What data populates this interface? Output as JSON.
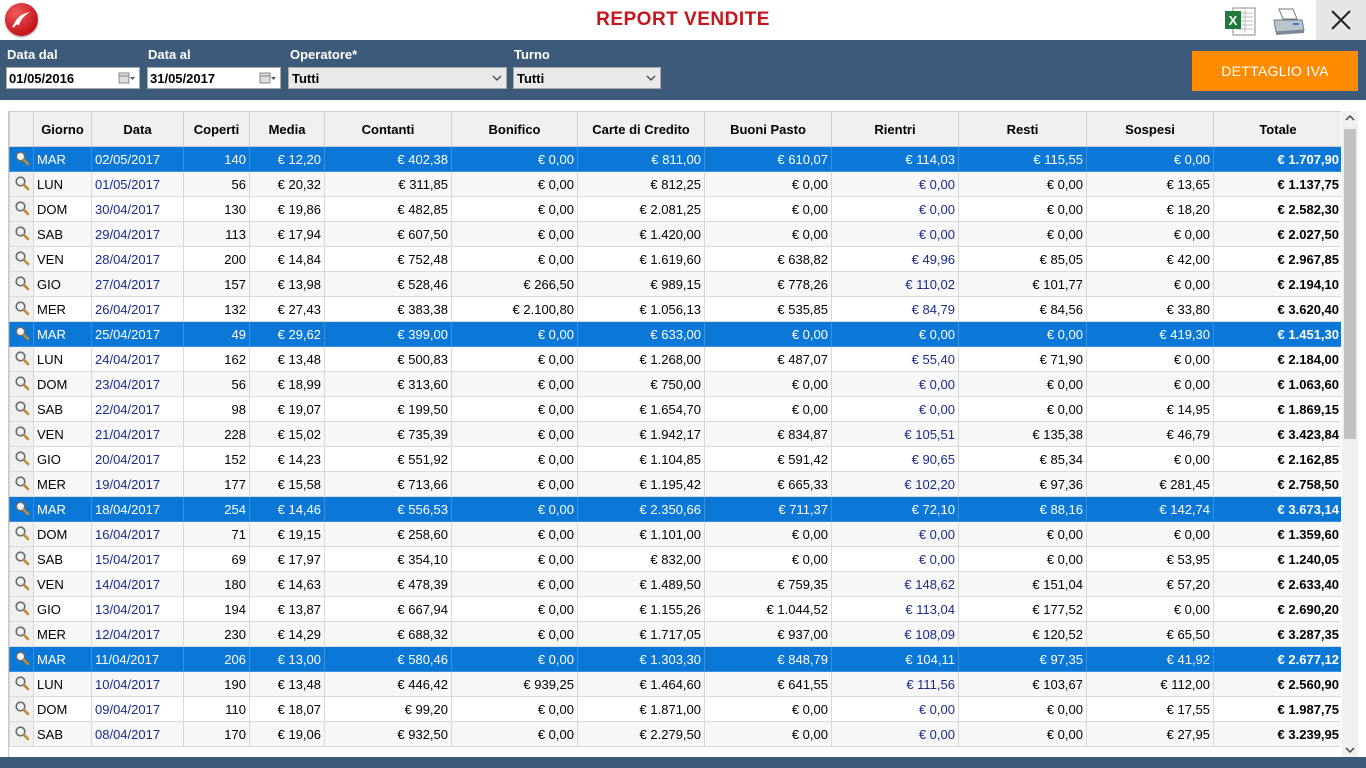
{
  "app": {
    "title": "REPORT VENDITE",
    "logo_icon": "app-logo",
    "accent_color": "#c4161c",
    "selection_color": "#0b78d7",
    "button_color": "#ff8c00"
  },
  "toolbar": {
    "excel_icon": "excel-export-icon",
    "print_icon": "printer-icon",
    "close_icon": "close-icon"
  },
  "filters": {
    "date_from_label": "Data dal",
    "date_from_value": "01/05/2016",
    "date_to_label": "Data al",
    "date_to_value": "31/05/2017",
    "operator_label": "Operatore*",
    "operator_value": "Tutti",
    "shift_label": "Turno",
    "shift_value": "Tutti",
    "iva_button": "DETTAGLIO IVA"
  },
  "table": {
    "headers": [
      "",
      "Giorno",
      "Data",
      "Coperti",
      "Media",
      "Contanti",
      "Bonifico",
      "Carte di Credito",
      "Buoni Pasto",
      "Rientri",
      "Resti",
      "Sospesi",
      "Totale"
    ],
    "rows": [
      {
        "sel": true,
        "cells": [
          "MAR",
          "02/05/2017",
          "140",
          "€ 12,20",
          "€ 402,38",
          "€ 0,00",
          "€ 811,00",
          "€ 610,07",
          "€ 114,03",
          "€ 115,55",
          "€ 0,00",
          "€ 1.707,90"
        ]
      },
      {
        "sel": false,
        "cells": [
          "LUN",
          "01/05/2017",
          "56",
          "€ 20,32",
          "€ 311,85",
          "€ 0,00",
          "€ 812,25",
          "€ 0,00",
          "€ 0,00",
          "€ 0,00",
          "€ 13,65",
          "€ 1.137,75"
        ]
      },
      {
        "sel": false,
        "cells": [
          "DOM",
          "30/04/2017",
          "130",
          "€ 19,86",
          "€ 482,85",
          "€ 0,00",
          "€ 2.081,25",
          "€ 0,00",
          "€ 0,00",
          "€ 0,00",
          "€ 18,20",
          "€ 2.582,30"
        ]
      },
      {
        "sel": false,
        "cells": [
          "SAB",
          "29/04/2017",
          "113",
          "€ 17,94",
          "€ 607,50",
          "€ 0,00",
          "€ 1.420,00",
          "€ 0,00",
          "€ 0,00",
          "€ 0,00",
          "€ 0,00",
          "€ 2.027,50"
        ]
      },
      {
        "sel": false,
        "cells": [
          "VEN",
          "28/04/2017",
          "200",
          "€ 14,84",
          "€ 752,48",
          "€ 0,00",
          "€ 1.619,60",
          "€ 638,82",
          "€ 49,96",
          "€ 85,05",
          "€ 42,00",
          "€ 2.967,85"
        ]
      },
      {
        "sel": false,
        "cells": [
          "GIO",
          "27/04/2017",
          "157",
          "€ 13,98",
          "€ 528,46",
          "€ 266,50",
          "€ 989,15",
          "€ 778,26",
          "€ 110,02",
          "€ 101,77",
          "€ 0,00",
          "€ 2.194,10"
        ]
      },
      {
        "sel": false,
        "cells": [
          "MER",
          "26/04/2017",
          "132",
          "€ 27,43",
          "€ 383,38",
          "€ 2.100,80",
          "€ 1.056,13",
          "€ 535,85",
          "€ 84,79",
          "€ 84,56",
          "€ 33,80",
          "€ 3.620,40"
        ]
      },
      {
        "sel": true,
        "cells": [
          "MAR",
          "25/04/2017",
          "49",
          "€ 29,62",
          "€ 399,00",
          "€ 0,00",
          "€ 633,00",
          "€ 0,00",
          "€ 0,00",
          "€ 0,00",
          "€ 419,30",
          "€ 1.451,30"
        ]
      },
      {
        "sel": false,
        "cells": [
          "LUN",
          "24/04/2017",
          "162",
          "€ 13,48",
          "€ 500,83",
          "€ 0,00",
          "€ 1.268,00",
          "€ 487,07",
          "€ 55,40",
          "€ 71,90",
          "€ 0,00",
          "€ 2.184,00"
        ]
      },
      {
        "sel": false,
        "cells": [
          "DOM",
          "23/04/2017",
          "56",
          "€ 18,99",
          "€ 313,60",
          "€ 0,00",
          "€ 750,00",
          "€ 0,00",
          "€ 0,00",
          "€ 0,00",
          "€ 0,00",
          "€ 1.063,60"
        ]
      },
      {
        "sel": false,
        "cells": [
          "SAB",
          "22/04/2017",
          "98",
          "€ 19,07",
          "€ 199,50",
          "€ 0,00",
          "€ 1.654,70",
          "€ 0,00",
          "€ 0,00",
          "€ 0,00",
          "€ 14,95",
          "€ 1.869,15"
        ]
      },
      {
        "sel": false,
        "cells": [
          "VEN",
          "21/04/2017",
          "228",
          "€ 15,02",
          "€ 735,39",
          "€ 0,00",
          "€ 1.942,17",
          "€ 834,87",
          "€ 105,51",
          "€ 135,38",
          "€ 46,79",
          "€ 3.423,84"
        ]
      },
      {
        "sel": false,
        "cells": [
          "GIO",
          "20/04/2017",
          "152",
          "€ 14,23",
          "€ 551,92",
          "€ 0,00",
          "€ 1.104,85",
          "€ 591,42",
          "€ 90,65",
          "€ 85,34",
          "€ 0,00",
          "€ 2.162,85"
        ]
      },
      {
        "sel": false,
        "cells": [
          "MER",
          "19/04/2017",
          "177",
          "€ 15,58",
          "€ 713,66",
          "€ 0,00",
          "€ 1.195,42",
          "€ 665,33",
          "€ 102,20",
          "€ 97,36",
          "€ 281,45",
          "€ 2.758,50"
        ]
      },
      {
        "sel": true,
        "cells": [
          "MAR",
          "18/04/2017",
          "254",
          "€ 14,46",
          "€ 556,53",
          "€ 0,00",
          "€ 2.350,66",
          "€ 711,37",
          "€ 72,10",
          "€ 88,16",
          "€ 142,74",
          "€ 3.673,14"
        ]
      },
      {
        "sel": false,
        "cells": [
          "DOM",
          "16/04/2017",
          "71",
          "€ 19,15",
          "€ 258,60",
          "€ 0,00",
          "€ 1.101,00",
          "€ 0,00",
          "€ 0,00",
          "€ 0,00",
          "€ 0,00",
          "€ 1.359,60"
        ]
      },
      {
        "sel": false,
        "cells": [
          "SAB",
          "15/04/2017",
          "69",
          "€ 17,97",
          "€ 354,10",
          "€ 0,00",
          "€ 832,00",
          "€ 0,00",
          "€ 0,00",
          "€ 0,00",
          "€ 53,95",
          "€ 1.240,05"
        ]
      },
      {
        "sel": false,
        "cells": [
          "VEN",
          "14/04/2017",
          "180",
          "€ 14,63",
          "€ 478,39",
          "€ 0,00",
          "€ 1.489,50",
          "€ 759,35",
          "€ 148,62",
          "€ 151,04",
          "€ 57,20",
          "€ 2.633,40"
        ]
      },
      {
        "sel": false,
        "cells": [
          "GIO",
          "13/04/2017",
          "194",
          "€ 13,87",
          "€ 667,94",
          "€ 0,00",
          "€ 1.155,26",
          "€ 1.044,52",
          "€ 113,04",
          "€ 177,52",
          "€ 0,00",
          "€ 2.690,20"
        ]
      },
      {
        "sel": false,
        "cells": [
          "MER",
          "12/04/2017",
          "230",
          "€ 14,29",
          "€ 688,32",
          "€ 0,00",
          "€ 1.717,05",
          "€ 937,00",
          "€ 108,09",
          "€ 120,52",
          "€ 65,50",
          "€ 3.287,35"
        ]
      },
      {
        "sel": true,
        "cells": [
          "MAR",
          "11/04/2017",
          "206",
          "€ 13,00",
          "€ 580,46",
          "€ 0,00",
          "€ 1.303,30",
          "€ 848,79",
          "€ 104,11",
          "€ 97,35",
          "€ 41,92",
          "€ 2.677,12"
        ]
      },
      {
        "sel": false,
        "cells": [
          "LUN",
          "10/04/2017",
          "190",
          "€ 13,48",
          "€ 446,42",
          "€ 939,25",
          "€ 1.464,60",
          "€ 641,55",
          "€ 111,56",
          "€ 103,67",
          "€ 112,00",
          "€ 2.560,90"
        ]
      },
      {
        "sel": false,
        "cells": [
          "DOM",
          "09/04/2017",
          "110",
          "€ 18,07",
          "€ 99,20",
          "€ 0,00",
          "€ 1.871,00",
          "€ 0,00",
          "€ 0,00",
          "€ 0,00",
          "€ 17,55",
          "€ 1.987,75"
        ]
      },
      {
        "sel": false,
        "cells": [
          "SAB",
          "08/04/2017",
          "170",
          "€ 19,06",
          "€ 932,50",
          "€ 0,00",
          "€ 2.279,50",
          "€ 0,00",
          "€ 0,00",
          "€ 0,00",
          "€ 27,95",
          "€ 3.239,95"
        ]
      }
    ]
  }
}
